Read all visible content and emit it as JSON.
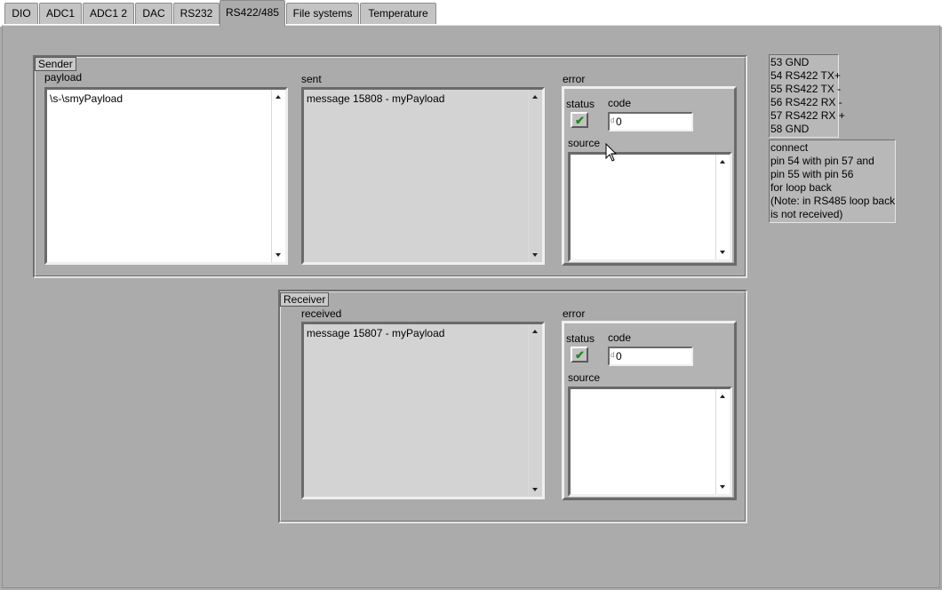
{
  "tabs": [
    "DIO",
    "ADC1",
    "ADC1 2",
    "DAC",
    "RS232",
    "RS422/485",
    "File systems",
    "Temperature"
  ],
  "active_tab": "RS422/485",
  "sender": {
    "label": "Sender",
    "payload_label": "payload",
    "payload_value": "\\s-\\smyPayload",
    "sent_label": "sent",
    "sent_value": "message 15808 - myPayload",
    "error": {
      "label": "error",
      "status_label": "status",
      "code_label": "code",
      "code_value": "0",
      "source_label": "source",
      "source_value": ""
    }
  },
  "receiver": {
    "label": "Receiver",
    "received_label": "received",
    "received_value": "message 15807 - myPayload",
    "error": {
      "label": "error",
      "status_label": "status",
      "code_label": "code",
      "code_value": "0",
      "source_label": "source",
      "source_value": ""
    }
  },
  "pinout": [
    "53 GND",
    "54 RS422 TX+",
    "55 RS422 TX -",
    "56 RS422 RX -",
    "57 RS422 RX +",
    "58 GND"
  ],
  "instructions": [
    "connect",
    "pin 54 with pin 57 and",
    "pin 55 with pin 56",
    "for loop back",
    "(Note: in RS485 loop back",
    "is not received)"
  ],
  "colors": {
    "status_ok": "#1e8a1e",
    "panel": "#ababab"
  },
  "icons": {
    "status": "checkmark-icon",
    "cursor": "mouse-pointer-icon"
  }
}
